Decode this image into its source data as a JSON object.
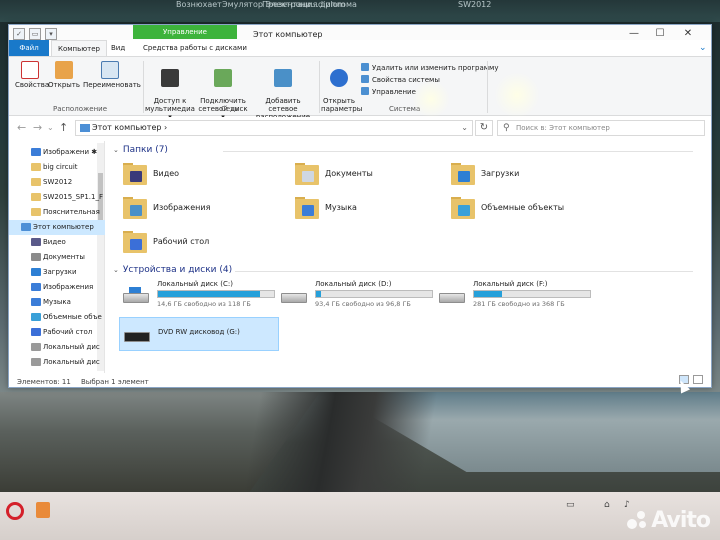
{
  "desktop": {
    "top_labels": [
      "Boзнюхает",
      "Эмулятор\nЭлектрони...",
      "Презентация\nдиплома",
      "diplom",
      "SW2012"
    ]
  },
  "window": {
    "ribbon_context_group": "Управление",
    "title": "Этот компьютер",
    "controls": {
      "minimize": "—",
      "maximize": "☐",
      "close": "✕"
    },
    "tabs": [
      {
        "label": "Файл"
      },
      {
        "label": "Компьютер"
      },
      {
        "label": "Вид"
      },
      {
        "label": "Средства работы с дисками"
      }
    ],
    "ribbon": {
      "location_group": {
        "label": "Расположение",
        "buttons": [
          "Свойства",
          "Открыть",
          "Переименовать"
        ]
      },
      "network_group": {
        "label": "Сеть",
        "buttons": [
          "Доступ к\nмультимедиа ▾",
          "Подключить\nсетевой диск ▾",
          "Добавить сетевое\nрасположение"
        ]
      },
      "system_group": {
        "label": "Система",
        "open_settings": "Открыть\nпараметры",
        "small_buttons": [
          "Удалить или изменить программу",
          "Свойства системы",
          "Управление"
        ]
      }
    },
    "address": {
      "path": "Этот компьютер  ›",
      "search_placeholder": "Поиск в: Этот компьютер"
    },
    "nav_pane": {
      "items": [
        {
          "label": "Изображени ✱",
          "color": "#3b7dd8"
        },
        {
          "label": "big circuit",
          "color": "#e8c36a"
        },
        {
          "label": "SW2012",
          "color": "#e8c36a"
        },
        {
          "label": "SW2015_SP1.1_F",
          "color": "#e8c36a"
        },
        {
          "label": "Пояснительная",
          "color": "#e8c36a"
        },
        {
          "label": "Этот компьютер",
          "color": "#4c8fd6",
          "selected": true
        },
        {
          "label": "Видео",
          "color": "#5a5a8a"
        },
        {
          "label": "Документы",
          "color": "#8b8b8b"
        },
        {
          "label": "Загрузки",
          "color": "#2d7fd4"
        },
        {
          "label": "Изображения",
          "color": "#3b7dd8"
        },
        {
          "label": "Музыка",
          "color": "#3b7dd8"
        },
        {
          "label": "Объемные объе",
          "color": "#3aa0d8"
        },
        {
          "label": "Рабочий стол",
          "color": "#3b6fd8"
        },
        {
          "label": "Локальный дис",
          "color": "#9a9a9a"
        },
        {
          "label": "Локальный дис",
          "color": "#9a9a9a"
        }
      ]
    },
    "folders_section": {
      "label": "Папки (7)",
      "folders": [
        {
          "label": "Видео",
          "color": "#3a3a7a"
        },
        {
          "label": "Документы",
          "color": "#cfd7e2"
        },
        {
          "label": "Загрузки",
          "color": "#2d7fd4"
        },
        {
          "label": "Изображения",
          "color": "#4a90c8"
        },
        {
          "label": "Музыка",
          "color": "#3b7dd8"
        },
        {
          "label": "Объемные объекты",
          "color": "#3aa0d8"
        },
        {
          "label": "Рабочий стол",
          "color": "#3b6fd8"
        }
      ]
    },
    "drives_section": {
      "label": "Устройства и диски (4)",
      "drives": [
        {
          "name": "Локальный диск (C:)",
          "free": "14,6 ГБ свободно из 118 ГБ",
          "used_fraction": 0.88
        },
        {
          "name": "Локальный диск (D:)",
          "free": "93,4 ГБ свободно из 96,8 ГБ",
          "used_fraction": 0.04
        },
        {
          "name": "Локальный диск (F:)",
          "free": "281 ГБ свободно из 368 ГБ",
          "used_fraction": 0.24
        },
        {
          "name": "DVD RW дисковод (G:)",
          "free": "",
          "used_fraction": null
        }
      ]
    },
    "status": {
      "items_count": "Элементов: 11",
      "selected": "Выбран 1 элемент"
    }
  },
  "watermark": {
    "text": "Avito"
  }
}
